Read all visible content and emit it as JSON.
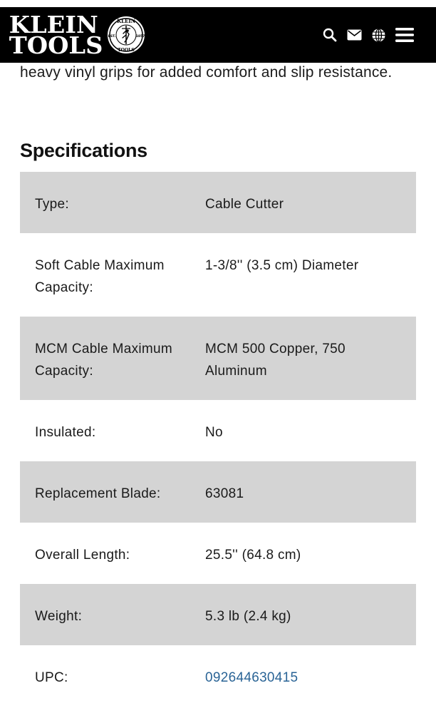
{
  "header": {
    "logo": {
      "line1": "KLEIN",
      "line2": "TOOLS",
      "seal_top": "KLEIN",
      "seal_left": "EST.",
      "seal_right": "1857",
      "seal_bottom": "TOOLS"
    },
    "icons": [
      "search-icon",
      "envelope-icon",
      "globe-icon",
      "menu-icon"
    ],
    "colors": {
      "background": "#000000",
      "foreground": "#ffffff"
    }
  },
  "intro": {
    "text": "heavy vinyl grips for added comfort and slip resistance."
  },
  "specs": {
    "heading": "Specifications",
    "rows": [
      {
        "label": "Type:",
        "value": "Cable Cutter"
      },
      {
        "label": "Soft Cable Maximum Capacity:",
        "value": "1-3/8'' (3.5 cm) Diameter"
      },
      {
        "label": "MCM Cable Maximum Capacity:",
        "value": "MCM 500 Copper, 750 Aluminum"
      },
      {
        "label": "Insulated:",
        "value": "No"
      },
      {
        "label": "Replacement Blade:",
        "value": "63081"
      },
      {
        "label": "Overall Length:",
        "value": "25.5'' (64.8 cm)"
      },
      {
        "label": "Weight:",
        "value": "5.3 lb (2.4 kg)"
      },
      {
        "label": "UPC:",
        "value": "092644630415"
      }
    ],
    "colors": {
      "row_shade": "#d4d4d4",
      "link": "#2a6496"
    }
  }
}
